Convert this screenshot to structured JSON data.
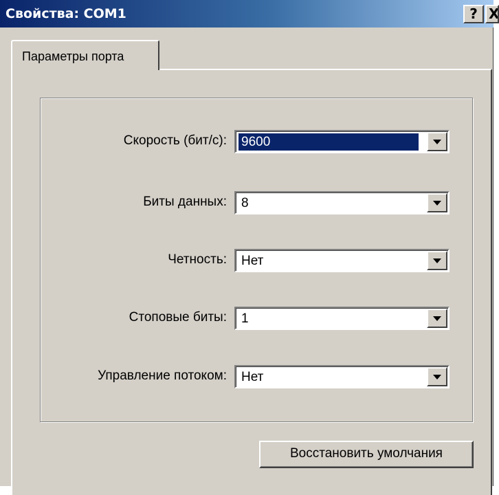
{
  "window": {
    "title": "Свойства: COM1",
    "help_label": "?",
    "close_label": "X"
  },
  "tabs": [
    {
      "label": "Параметры порта",
      "active": true
    }
  ],
  "settings": [
    {
      "label": "Скорость (бит/с):",
      "value": "9600",
      "selected": true
    },
    {
      "label": "Биты данных:",
      "value": "8",
      "selected": false
    },
    {
      "label": "Четность:",
      "value": "Нет",
      "selected": false
    },
    {
      "label": "Стоповые биты:",
      "value": "1",
      "selected": false
    },
    {
      "label": "Управление потоком:",
      "value": "Нет",
      "selected": false
    }
  ],
  "buttons": {
    "restore_defaults": "Восстановить умолчания"
  },
  "colors": {
    "title_bar_start": "#0a246a",
    "title_bar_end": "#a6caf0",
    "face": "#d4d0c8",
    "selection": "#0a246a"
  }
}
